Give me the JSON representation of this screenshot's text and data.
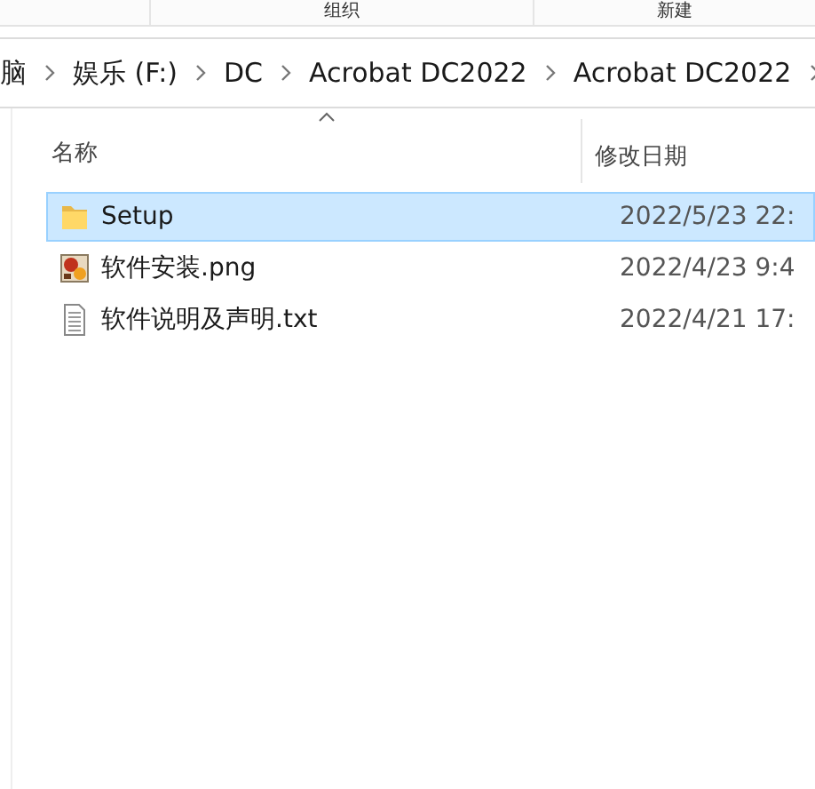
{
  "ribbon": {
    "groups": [
      "组织",
      "新建"
    ]
  },
  "address_bar": {
    "segments": [
      "脑",
      "娱乐 (F:)",
      "DC",
      "Acrobat DC2022",
      "Acrobat DC2022"
    ]
  },
  "file_list": {
    "columns": [
      {
        "label": "名称",
        "sorted": true
      },
      {
        "label": "修改日期",
        "sorted": false
      }
    ],
    "rows": [
      {
        "name": "Setup",
        "kind": "folder",
        "modified": "2022/5/23 22:",
        "selected": true
      },
      {
        "name": "软件安装.png",
        "kind": "image",
        "modified": "2022/4/23 9:4",
        "selected": false
      },
      {
        "name": "软件说明及声明.txt",
        "kind": "text",
        "modified": "2022/4/21 17:",
        "selected": false
      }
    ]
  }
}
